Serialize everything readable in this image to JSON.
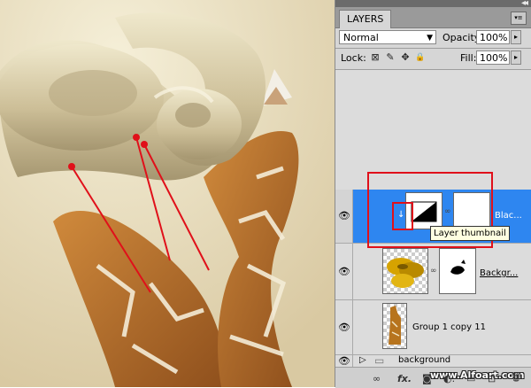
{
  "panel": {
    "collapse_glyph": "◂◂",
    "tab_label": "LAYERS",
    "menu_glyph": "▾≡",
    "blend_mode": "Normal",
    "opacity_label": "Opacity:",
    "opacity_value": "100%",
    "lock_label": "Lock:",
    "fill_label": "Fill:",
    "fill_value": "100%",
    "flyout_glyph": "▸"
  },
  "layers": [
    {
      "name": "Blac...",
      "selected": true,
      "visible": true,
      "clip_glyph": "↓"
    },
    {
      "name": "Backgr...",
      "selected": false,
      "visible": true
    },
    {
      "name": "Group 1 copy 11",
      "selected": false,
      "visible": true
    },
    {
      "name": "background",
      "selected": false,
      "visible": true,
      "is_group": true
    }
  ],
  "tooltip": "Layer thumbnail",
  "watermark": "www.Alfoart.com",
  "icons": {
    "eye": "👁",
    "link": "∞",
    "folder": "▭",
    "expand": "▷",
    "lock_transparent": "⊠",
    "lock_paint": "✎",
    "lock_move": "✥",
    "lock_all": "🔒",
    "fx": "fx.",
    "mask": "◙",
    "adjust": "◐.",
    "new_group": "▭",
    "new_layer": "⊡",
    "trash": "🗑"
  },
  "colors": {
    "selected_row": "#2e86f0",
    "annotation_red": "#e0101a",
    "canvas_bg": "#efe7cc"
  }
}
